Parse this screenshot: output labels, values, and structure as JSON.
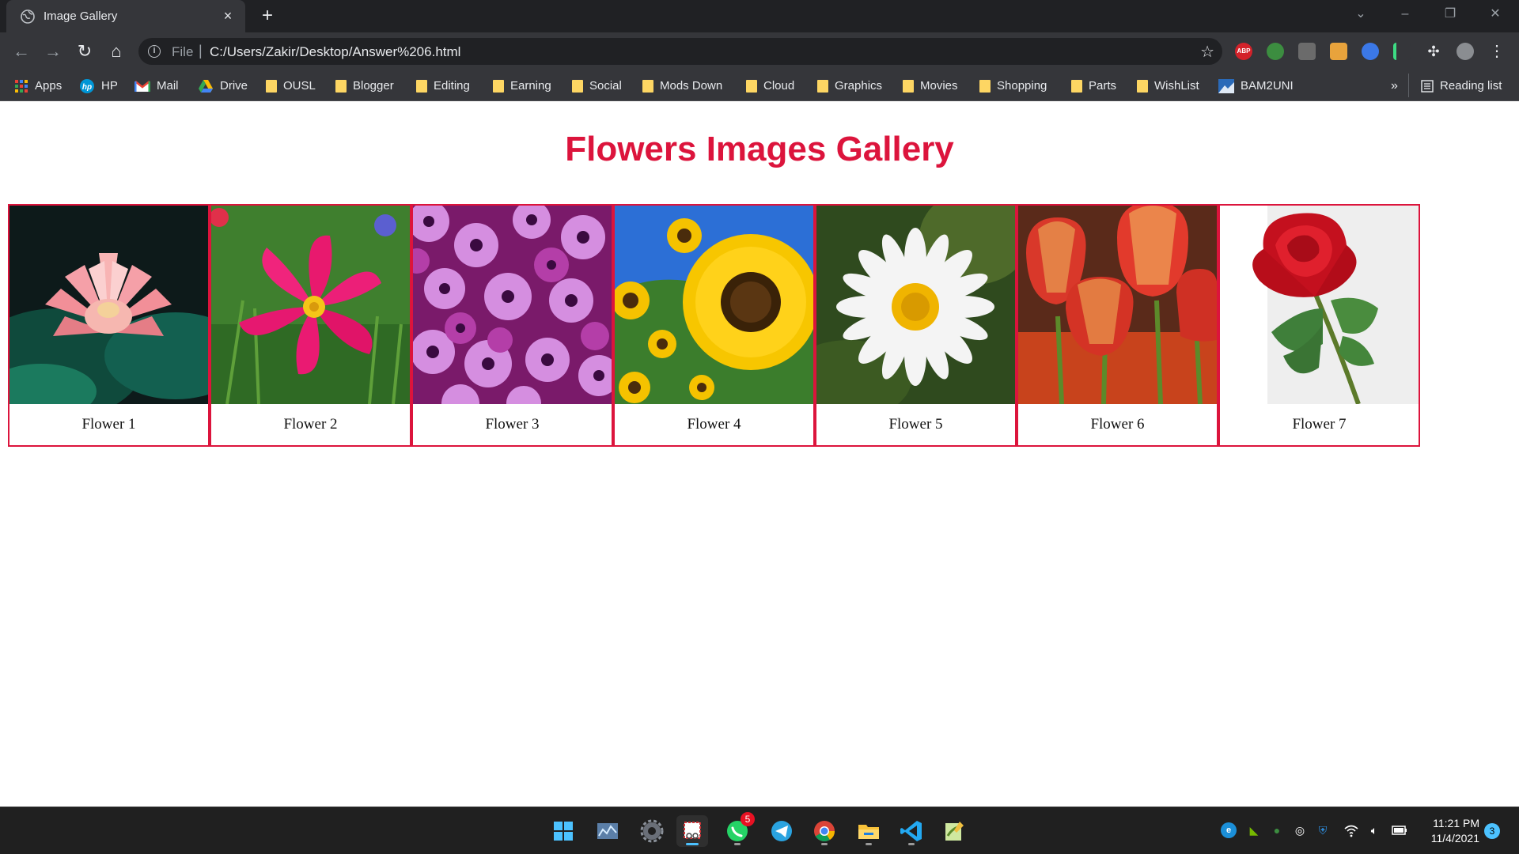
{
  "browser": {
    "tab": {
      "title": "Image Gallery",
      "close": "×"
    },
    "new_tab": "+",
    "omnibox": {
      "scheme": "File",
      "separator": "|",
      "url": "C:/Users/Zakir/Desktop/Answer%206.html"
    },
    "ext_abp": "ABP",
    "bookmarks": [
      {
        "label": "Apps",
        "icon": "apps-grid-icon"
      },
      {
        "label": "HP",
        "icon": "hp-icon"
      },
      {
        "label": "Mail",
        "icon": "gmail-icon"
      },
      {
        "label": "Drive",
        "icon": "drive-icon"
      },
      {
        "label": "OUSL",
        "icon": "folder-icon"
      },
      {
        "label": "Blogger",
        "icon": "folder-icon"
      },
      {
        "label": "Editing",
        "icon": "folder-icon"
      },
      {
        "label": "Earning",
        "icon": "folder-icon"
      },
      {
        "label": "Social",
        "icon": "folder-icon"
      },
      {
        "label": "Mods Down",
        "icon": "folder-icon"
      },
      {
        "label": "Cloud",
        "icon": "folder-icon"
      },
      {
        "label": "Graphics",
        "icon": "folder-icon"
      },
      {
        "label": "Movies",
        "icon": "folder-icon"
      },
      {
        "label": "Shopping",
        "icon": "folder-icon"
      },
      {
        "label": "Parts",
        "icon": "folder-icon"
      },
      {
        "label": "WishList",
        "icon": "folder-icon"
      },
      {
        "label": "BAM2UNI",
        "icon": "site-icon"
      }
    ],
    "bookmarks_overflow": "»",
    "reading_list": "Reading list"
  },
  "page": {
    "title": "Flowers Images Gallery",
    "accent_color": "#dc143c",
    "flowers": [
      {
        "caption": "Flower 1",
        "subject": "pink water lily"
      },
      {
        "caption": "Flower 2",
        "subject": "magenta cosmos"
      },
      {
        "caption": "Flower 3",
        "subject": "purple daisies"
      },
      {
        "caption": "Flower 4",
        "subject": "sunflowers"
      },
      {
        "caption": "Flower 5",
        "subject": "white daisy"
      },
      {
        "caption": "Flower 6",
        "subject": "red tulips"
      },
      {
        "caption": "Flower 7",
        "subject": "red rose"
      }
    ]
  },
  "taskbar": {
    "whatsapp_badge": "5",
    "clock_time": "11:21 PM",
    "clock_date": "11/4/2021",
    "notifications": "3"
  }
}
